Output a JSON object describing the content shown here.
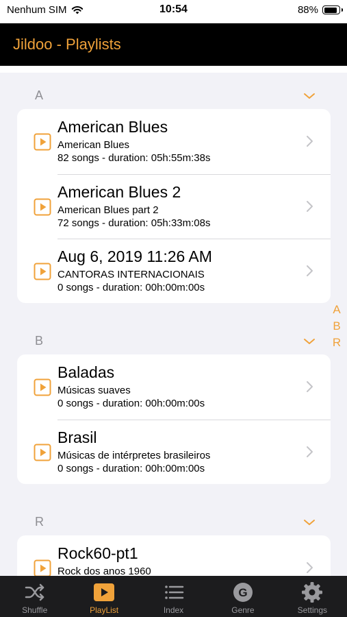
{
  "status": {
    "carrier": "Nenhum SIM",
    "time": "10:54",
    "battery": "88%",
    "battery_level": 0.88
  },
  "header": {
    "title": "Jildoo - Playlists"
  },
  "sections": [
    {
      "letter": "A",
      "items": [
        {
          "title": "American Blues",
          "subtitle": "American Blues",
          "meta": "82 songs - duration: 05h:55m:38s"
        },
        {
          "title": "American Blues 2",
          "subtitle": "American Blues part 2",
          "meta": "72 songs - duration: 05h:33m:08s"
        },
        {
          "title": "Aug 6, 2019 11:26 AM",
          "subtitle": "CANTORAS INTERNACIONAIS",
          "meta": "0 songs - duration: 00h:00m:00s"
        }
      ]
    },
    {
      "letter": "B",
      "items": [
        {
          "title": "Baladas",
          "subtitle": "Músicas suaves",
          "meta": "0 songs - duration: 00h:00m:00s"
        },
        {
          "title": "Brasil",
          "subtitle": "Músicas de intérpretes brasileiros",
          "meta": "0 songs - duration: 00h:00m:00s"
        }
      ]
    },
    {
      "letter": "R",
      "items": [
        {
          "title": "Rock60-pt1",
          "subtitle": "Rock dos anos 1960",
          "meta": ""
        }
      ]
    }
  ],
  "index_letters": [
    "A",
    "B",
    "R"
  ],
  "tabs": [
    {
      "label": "Shuffle",
      "icon": "shuffle-icon"
    },
    {
      "label": "PlayList",
      "icon": "playlist-icon",
      "active": true
    },
    {
      "label": "Index",
      "icon": "index-list-icon"
    },
    {
      "label": "Genre",
      "icon": "genre-icon",
      "glyph": "G"
    },
    {
      "label": "Settings",
      "icon": "gear-icon"
    }
  ],
  "colors": {
    "accent": "#f0a23a",
    "header_bg": "#000000",
    "tab_bg": "#1c1c1e",
    "background": "#f2f2f7"
  }
}
